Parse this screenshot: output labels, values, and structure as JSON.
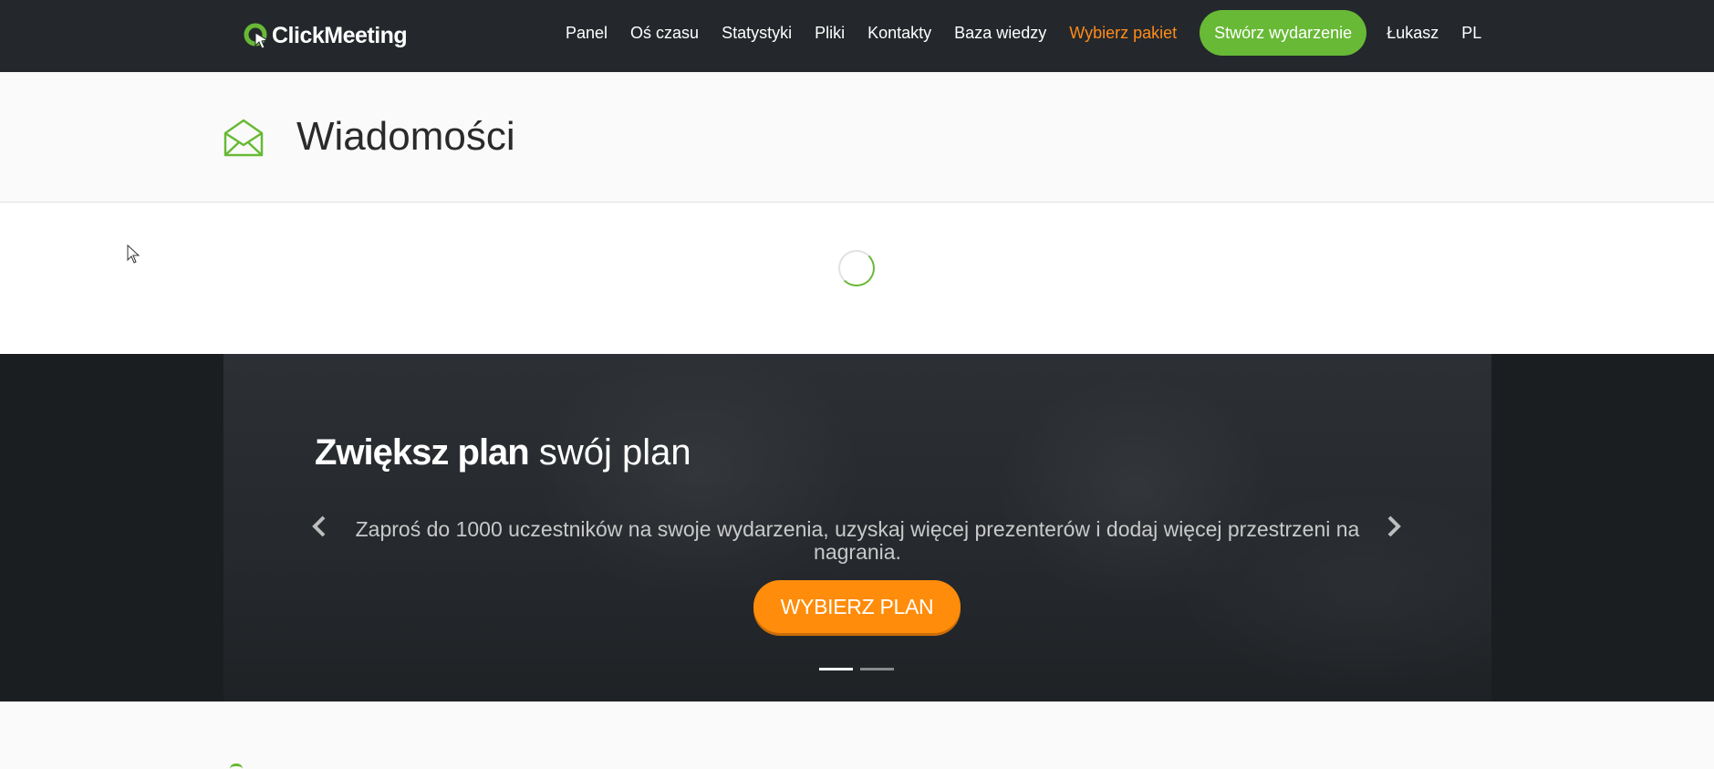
{
  "topbar": {
    "logo_text": "ClickMeeting",
    "nav_items": [
      "Panel",
      "Oś czasu",
      "Statystyki",
      "Pliki",
      "Kontakty",
      "Baza wiedzy"
    ],
    "upgrade_label": "Wybierz pakiet",
    "create_event_label": "Stwórz wydarzenie",
    "user_name": "Łukasz",
    "language": "PL"
  },
  "page": {
    "title": "Wiadomości",
    "icon": "envelope-open-icon",
    "loading": true
  },
  "promo": {
    "title_bold": "Zwiększ plan",
    "title_rest": " swój plan",
    "text": "Zaproś do 1000 uczestników na swoje wydarzenia, uzyskaj więcej prezenterów i dodaj więcej przestrzeni na nagrania.",
    "cta_label": "WYBIERZ PLAN",
    "slides": 2,
    "active_slide": 1
  },
  "colors": {
    "brand_green": "#68b936",
    "accent_orange": "#ff8c0a",
    "topbar_bg": "#24282c"
  }
}
